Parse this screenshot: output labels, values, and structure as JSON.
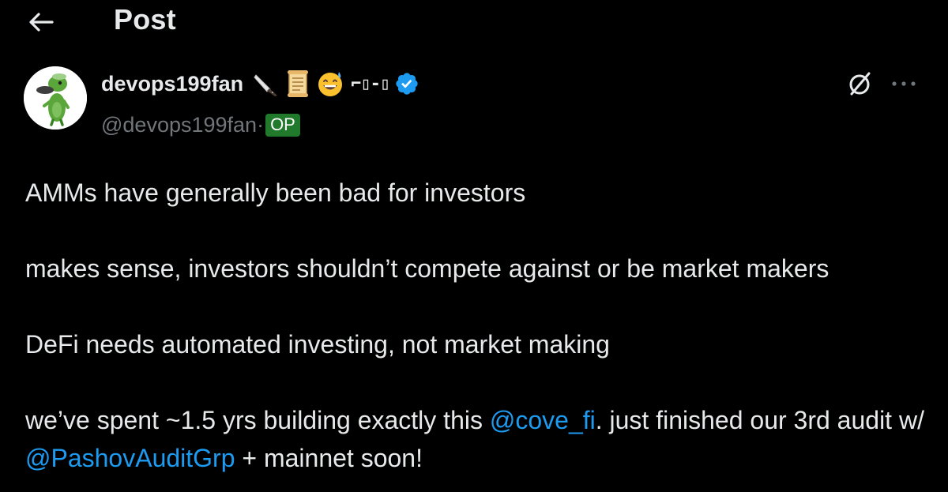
{
  "header": {
    "title": "Post",
    "back_icon": "arrow-left-icon"
  },
  "author": {
    "display_name": "devops199fan",
    "name_emojis": [
      "kitchen-knife-icon",
      "scroll-icon",
      "grinning-sweat-icon"
    ],
    "name_suffix": "⌐▯-▯",
    "verified_icon": "verified-badge-icon",
    "handle": "@devops199fan",
    "separator": "·",
    "badge": "OP",
    "avatar_icon": "platypus-avatar"
  },
  "actions": {
    "grok_icon": "grok-icon",
    "more_icon": "more-horizontal-icon"
  },
  "tweet": {
    "line1": "AMMs have generally been bad for investors",
    "line2": "makes sense, investors shouldn’t compete against or be market makers",
    "line3": "DeFi needs automated investing, not market making",
    "line4_part1": "we’ve spent ~1.5 yrs building exactly this ",
    "mention1": "@cove_fi",
    "line4_part2": ". just finished our 3rd audit w/ ",
    "mention2": "@PashovAuditGrp",
    "line4_part3": " + mainnet soon!"
  },
  "colors": {
    "background": "#000000",
    "text": "#e7e9ea",
    "secondary": "#71767b",
    "link": "#1d9bf0",
    "op_badge": "#217a2c",
    "verified": "#1d9bf0"
  }
}
